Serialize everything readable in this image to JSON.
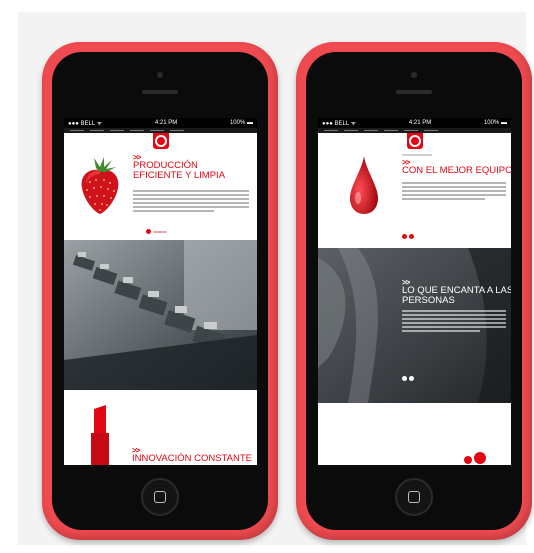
{
  "phones": [
    {
      "status": {
        "carrier": "●●● BELL ᯤ",
        "time": "4:21 PM",
        "battery": "100% ▬"
      },
      "section1": {
        "chevron": ">>",
        "title_line1": "PRODUCCIÓN",
        "title_line2": "EFICIENTE Y LIMPIA"
      },
      "section3": {
        "chevron": ">>",
        "title": "INNOVACIÓN CONSTANTE"
      },
      "colors": {
        "accent": "#e30613"
      }
    },
    {
      "status": {
        "carrier": "●●● BELL ᯤ",
        "time": "4:21 PM",
        "battery": "100% ▬"
      },
      "section1": {
        "chevron": ">>",
        "title": "CON EL MEJOR EQUIPO"
      },
      "section2": {
        "chevron": ">>",
        "title_line1": "LO QUE ENCANTA A LAS",
        "title_line2": "PERSONAS"
      },
      "colors": {
        "accent": "#e30613"
      }
    }
  ]
}
